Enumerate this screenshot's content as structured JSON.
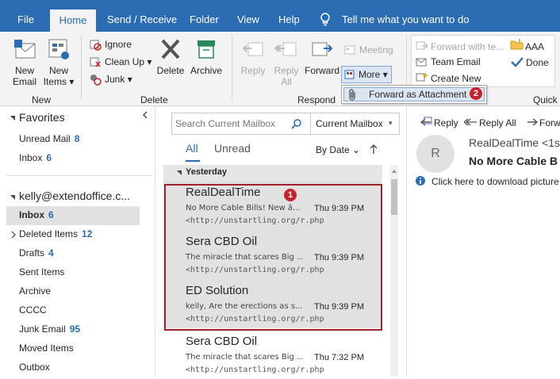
{
  "tabs": [
    "File",
    "Home",
    "Send / Receive",
    "Folder",
    "View",
    "Help"
  ],
  "tell_me": "Tell me what you want to do",
  "ribbon": {
    "new_email": [
      "New",
      "Email"
    ],
    "new_items": [
      "New",
      "Items"
    ],
    "ignore": "Ignore",
    "clean_up": "Clean Up",
    "junk": "Junk",
    "delete": "Delete",
    "archive": "Archive",
    "reply": "Reply",
    "reply_all": [
      "Reply",
      "All"
    ],
    "forward": "Forward",
    "meeting": "Meeting",
    "more": "More",
    "forward_as_attachment": "Forward as Attachment",
    "qs_forward": "Forward with te...",
    "qs_team": "Team Email",
    "qs_create": "Create New",
    "qs_aaa": "AAA",
    "qs_done": "Done",
    "group_new": "New",
    "group_delete": "Delete",
    "group_respond": "Respond",
    "group_quick": "Quick"
  },
  "badges": {
    "one": "1",
    "two": "2"
  },
  "folders": {
    "favorites": "Favorites",
    "fav_items": [
      {
        "name": "Unread Mail",
        "count": "8"
      },
      {
        "name": "Inbox",
        "count": "6"
      }
    ],
    "account": "kelly@extendoffice.c...",
    "items": [
      {
        "name": "Inbox",
        "count": "6"
      },
      {
        "name": "Deleted Items",
        "count": "12"
      },
      {
        "name": "Drafts",
        "count": "4"
      },
      {
        "name": "Sent Items",
        "count": ""
      },
      {
        "name": "Archive",
        "count": ""
      },
      {
        "name": "CCCC",
        "count": ""
      },
      {
        "name": "Junk Email",
        "count": "95"
      },
      {
        "name": "Moved Items",
        "count": ""
      },
      {
        "name": "Outbox",
        "count": ""
      }
    ]
  },
  "search": {
    "placeholder": "Search Current Mailbox",
    "scope": "Current Mailbox"
  },
  "filters": {
    "all": "All",
    "unread": "Unread",
    "sort": "By Date"
  },
  "group_header": "Yesterday",
  "messages": [
    {
      "sender": "RealDealTime",
      "preview": "No More Cable Bills! New â...",
      "time": "Thu 9:39 PM",
      "url": "<http://unstartling.org/r.php"
    },
    {
      "sender": "Sera CBD Oil",
      "preview": "The miracle that scares Big ...",
      "time": "Thu 9:39 PM",
      "url": "<http://unstartling.org/r.php"
    },
    {
      "sender": "ED Solution",
      "preview": "kelly, Are the erections as s...",
      "time": "Thu 9:39 PM",
      "url": "<http://unstartling.org/r.php"
    },
    {
      "sender": "Sera CBD Oil",
      "preview": "The miracle that scares Big ...",
      "time": "Thu 7:32 PM",
      "url": "<http://unstartling.org/r.php"
    }
  ],
  "reading": {
    "reply": "Reply",
    "reply_all": "Reply All",
    "forward": "Forw",
    "avatar": "R",
    "sender": "RealDealTime <1s",
    "subject": "No More Cable B",
    "info": "Click here to download picture"
  }
}
